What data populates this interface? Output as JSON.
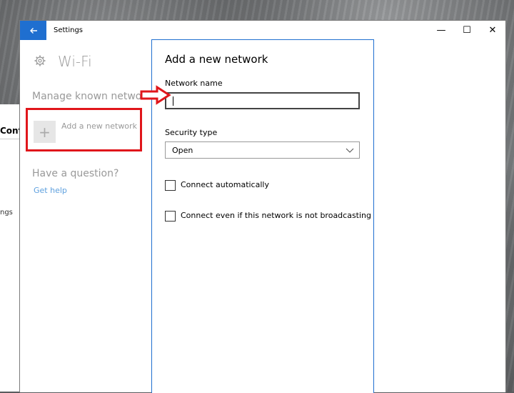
{
  "background_window": {
    "partial_heading": "Cont",
    "partial_link": "ngs"
  },
  "window": {
    "title": "Settings",
    "minimize_glyph": "—",
    "maximize_glyph": "☐",
    "close_glyph": "✕"
  },
  "sidebar": {
    "page_title": "Wi-Fi",
    "section_heading": "Manage known netwo",
    "add_network_label": "Add a new network",
    "add_glyph": "+",
    "question_heading": "Have a question?",
    "help_link": "Get help"
  },
  "dialog": {
    "title": "Add a new network",
    "network_name_label": "Network name",
    "network_name_value": "",
    "security_type_label": "Security type",
    "security_type_value": "Open",
    "connect_auto_label": "Connect automatically",
    "connect_auto_checked": false,
    "connect_hidden_label": "Connect even if this network is not broadcasting",
    "connect_hidden_checked": false
  },
  "colors": {
    "accent": "#1f6fd0",
    "annotation_red": "#e0161b",
    "link": "#5ea0de"
  },
  "icons": [
    "back-arrow-icon",
    "gear-icon",
    "plus-icon",
    "chevron-down-icon",
    "red-arrow-annotation"
  ]
}
